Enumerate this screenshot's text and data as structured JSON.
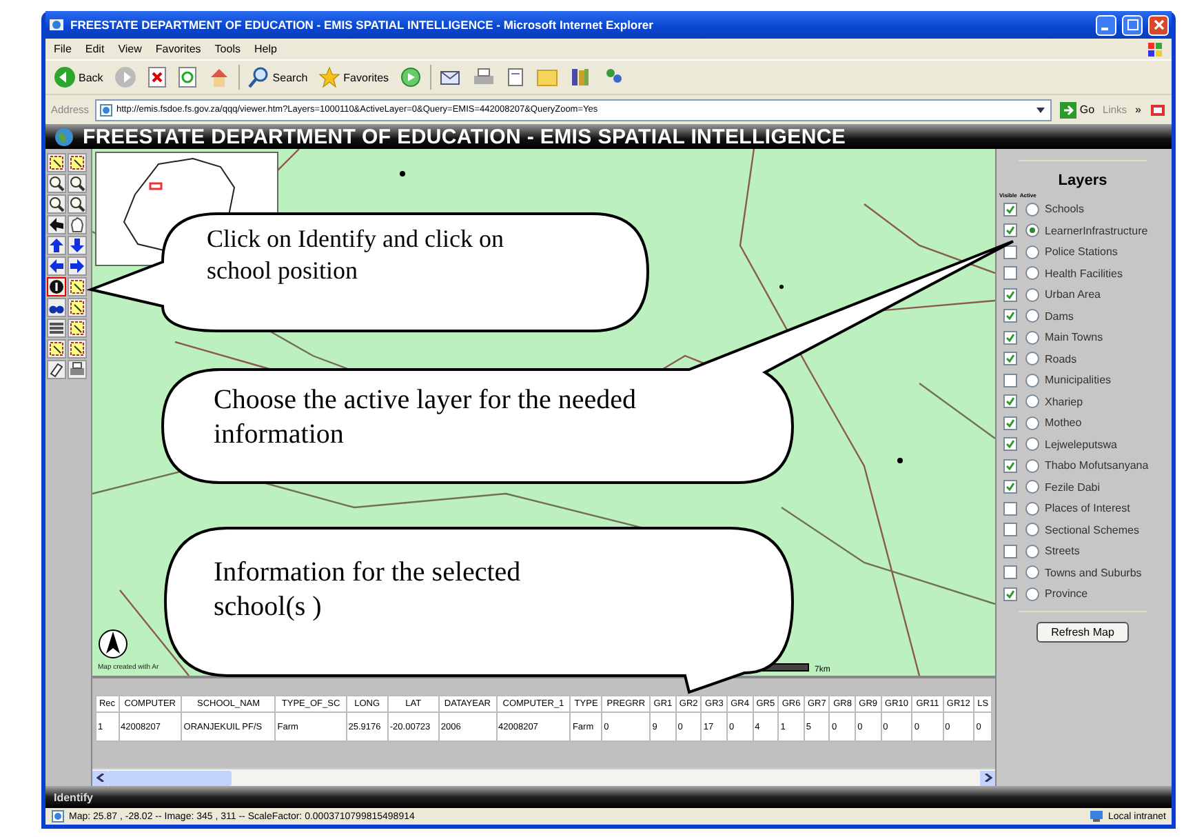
{
  "window": {
    "title": "FREESTATE DEPARTMENT OF EDUCATION - EMIS SPATIAL INTELLIGENCE - Microsoft Internet Explorer"
  },
  "menu": [
    "File",
    "Edit",
    "View",
    "Favorites",
    "Tools",
    "Help"
  ],
  "toolbar": {
    "back": "Back",
    "search": "Search",
    "favorites": "Favorites"
  },
  "address_bar": {
    "label": "Address",
    "url": "http://emis.fsdoe.fs.gov.za/qqq/viewer.htm?Layers=1000110&ActiveLayer=0&Query=EMIS=442008207&QueryZoom=Yes",
    "go": "Go",
    "links": "Links",
    "links_more": "»"
  },
  "app": {
    "title": "FREESTATE DEPARTMENT OF EDUCATION - EMIS SPATIAL INTELLIGENCE"
  },
  "tools": [
    {
      "selected": false
    },
    {
      "selected": false
    },
    {
      "selected": false
    },
    {
      "selected": false
    },
    {
      "selected": false
    },
    {
      "selected": false
    },
    {
      "selected": false
    },
    {
      "selected": false
    },
    {
      "selected": false
    },
    {
      "selected": false
    },
    {
      "selected": false
    },
    {
      "selected": false
    },
    {
      "selected": true
    },
    {
      "selected": false
    },
    {
      "selected": false
    },
    {
      "selected": false
    },
    {
      "selected": false
    },
    {
      "selected": false
    },
    {
      "selected": false
    },
    {
      "selected": false
    },
    {
      "selected": false
    },
    {
      "selected": false
    }
  ],
  "map": {
    "credit": "Map created with Ar",
    "scale_label": "7km"
  },
  "layers": {
    "title": "Layers",
    "visible_header": "Visible",
    "active_header": "Active",
    "button": "Refresh Map",
    "items": [
      {
        "name": "Schools",
        "visible": true,
        "selected": false
      },
      {
        "name": "LearnerInfrastructure",
        "visible": true,
        "selected": true
      },
      {
        "name": "Police Stations",
        "visible": false,
        "selected": false
      },
      {
        "name": "Health Facilities",
        "visible": false,
        "selected": false
      },
      {
        "name": "Urban Area",
        "visible": true,
        "selected": false
      },
      {
        "name": "Dams",
        "visible": true,
        "selected": false
      },
      {
        "name": "Main Towns",
        "visible": true,
        "selected": false
      },
      {
        "name": "Roads",
        "visible": true,
        "selected": false
      },
      {
        "name": "Municipalities",
        "visible": false,
        "selected": false
      },
      {
        "name": "Xhariep",
        "visible": true,
        "selected": false
      },
      {
        "name": "Motheo",
        "visible": true,
        "selected": false
      },
      {
        "name": "Lejweleputswa",
        "visible": true,
        "selected": false
      },
      {
        "name": "Thabo Mofutsanyana",
        "visible": true,
        "selected": false
      },
      {
        "name": "Fezile Dabi",
        "visible": true,
        "selected": false
      },
      {
        "name": "Places of Interest",
        "visible": false,
        "selected": false
      },
      {
        "name": "Sectional Schemes",
        "visible": false,
        "selected": false
      },
      {
        "name": "Streets",
        "visible": false,
        "selected": false
      },
      {
        "name": "Towns and Suburbs",
        "visible": false,
        "selected": false
      },
      {
        "name": "Province",
        "visible": true,
        "selected": false
      }
    ]
  },
  "results": {
    "columns": [
      "Rec",
      "COMPUTER",
      "SCHOOL_NAM",
      "TYPE_OF_SC",
      "LONG",
      "LAT",
      "DATAYEAR",
      "COMPUTER_1",
      "TYPE",
      "PREGRR",
      "GR1",
      "GR2",
      "GR3",
      "GR4",
      "GR5",
      "GR6",
      "GR7",
      "GR8",
      "GR9",
      "GR10",
      "GR11",
      "GR12",
      "LS"
    ],
    "rows": [
      [
        "1",
        "42008207",
        "ORANJEKUIL PF/S",
        "Farm",
        "25.9176",
        "-20.00723",
        "2006",
        "42008207",
        "Farm",
        "0",
        "9",
        "0",
        "17",
        "0",
        "4",
        "1",
        "5",
        "0",
        "0",
        "0",
        "0",
        "0",
        "0"
      ]
    ]
  },
  "function_bar": {
    "label": "Identify"
  },
  "status_bar": {
    "text": "Map: 25.87 , -28.02 -- Image: 345 , 311 -- ScaleFactor: 0.0003710799815498914",
    "zone": "Local intranet"
  },
  "callouts": [
    {
      "text": "Click on Identify and click on school position"
    },
    {
      "text": "Choose the active layer for the needed information"
    },
    {
      "text": "Information for the selected school(s )"
    }
  ]
}
